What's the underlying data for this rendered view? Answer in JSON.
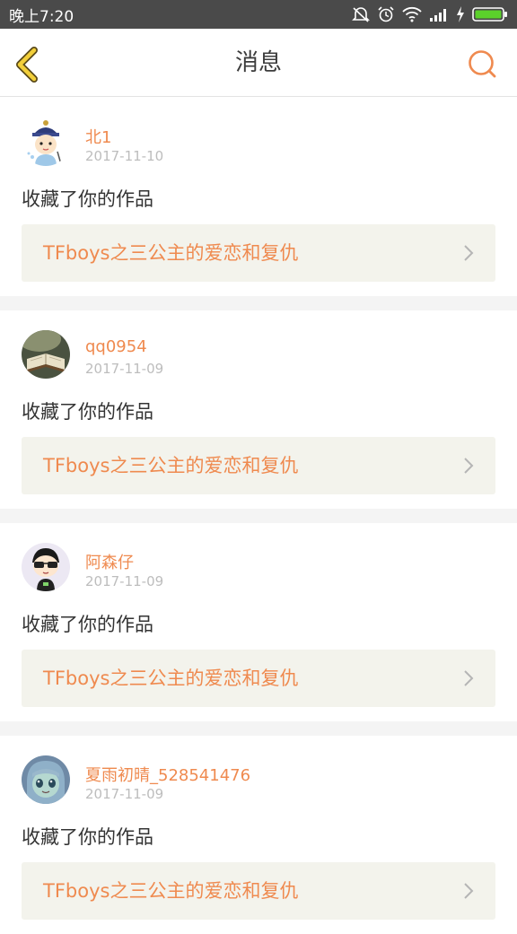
{
  "status_bar": {
    "time": "晚上7:20",
    "icons": [
      "silent-icon",
      "alarm-icon",
      "wifi-icon",
      "signal-icon",
      "charging-icon",
      "battery-icon"
    ],
    "battery_color": "#5bd12b"
  },
  "header": {
    "title": "消息",
    "back_icon": "chevron-left-icon",
    "search_icon": "search-icon"
  },
  "theme": {
    "accent": "#ef8a4f",
    "back_icon_color": "#f2cf3a",
    "work_card_bg": "#f3f3ec"
  },
  "messages": [
    {
      "username": "北1",
      "date": "2017-11-10",
      "action": "收藏了你的作品",
      "work_title": "TFboys之三公主的爱恋和复仇",
      "avatar": "cartoon-official-avatar"
    },
    {
      "username": "qq0954",
      "date": "2017-11-09",
      "action": "收藏了你的作品",
      "work_title": "TFboys之三公主的爱恋和复仇",
      "avatar": "open-book-avatar"
    },
    {
      "username": "阿森仔",
      "date": "2017-11-09",
      "action": "收藏了你的作品",
      "work_title": "TFboys之三公主的爱恋和复仇",
      "avatar": "sunglasses-cartoon-avatar"
    },
    {
      "username": "夏雨初晴_528541476",
      "date": "2017-11-09",
      "action": "收藏了你的作品",
      "work_title": "TFboys之三公主的爱恋和复仇",
      "avatar": "anime-girl-avatar"
    }
  ]
}
